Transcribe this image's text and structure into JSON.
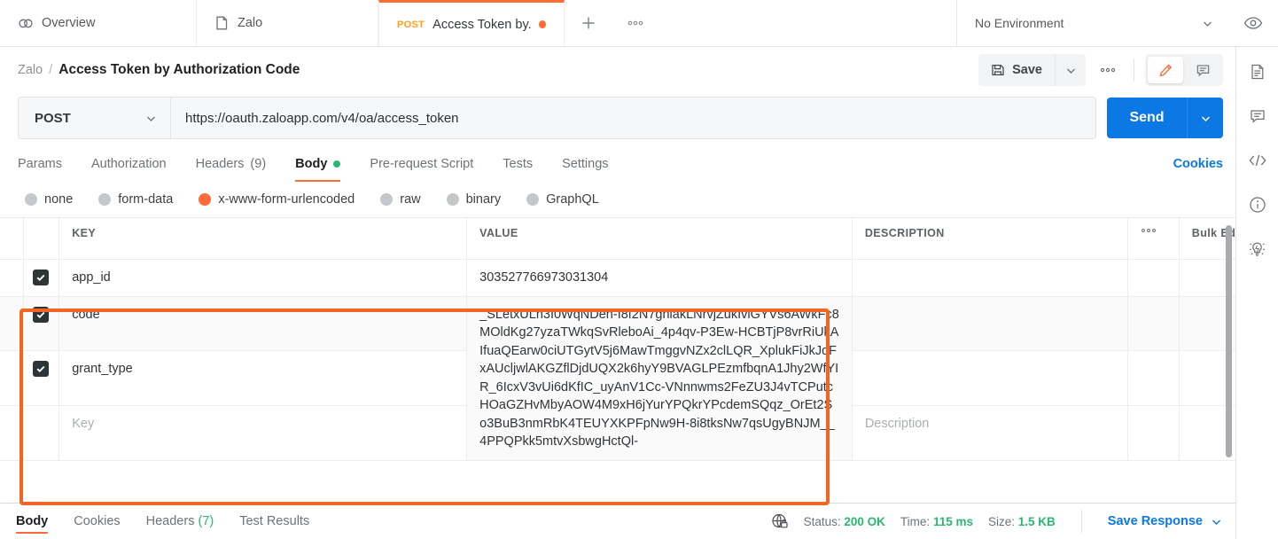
{
  "tabs": [
    {
      "label": "Overview",
      "icon": "postman-overview-icon"
    },
    {
      "label": "Zalo",
      "icon": "collection-icon"
    },
    {
      "label": "Access Token by...",
      "method": "POST",
      "icon": "request-icon"
    }
  ],
  "tabbar": {
    "add_label": "+",
    "more_label": "000",
    "environment": "No Environment",
    "eye_icon": "eye-icon"
  },
  "breadcrumb": {
    "collection": "Zalo",
    "separator": "/",
    "title": "Access Token by Authorization Code"
  },
  "actions": {
    "save_label": "Save",
    "save_caret": "chevron-down-icon",
    "more_label": "000",
    "edit_icon": "pencil-icon",
    "comment_icon": "comment-icon"
  },
  "request": {
    "method": "POST",
    "url": "https://oauth.zaloapp.com/v4/oa/access_token",
    "send_label": "Send"
  },
  "request_tabs": [
    {
      "label": "Params",
      "active": false
    },
    {
      "label": "Authorization",
      "active": false
    },
    {
      "label": "Headers",
      "count": "(9)",
      "active": false
    },
    {
      "label": "Body",
      "active": true,
      "dot": true
    },
    {
      "label": "Pre-request Script",
      "active": false
    },
    {
      "label": "Tests",
      "active": false
    },
    {
      "label": "Settings",
      "active": false
    }
  ],
  "cookies_link": "Cookies",
  "body_types": [
    {
      "label": "none",
      "selected": false
    },
    {
      "label": "form-data",
      "selected": false
    },
    {
      "label": "x-www-form-urlencoded",
      "selected": true
    },
    {
      "label": "raw",
      "selected": false
    },
    {
      "label": "binary",
      "selected": false
    },
    {
      "label": "GraphQL",
      "selected": false
    }
  ],
  "table": {
    "headers": {
      "key": "KEY",
      "value": "VALUE",
      "description": "DESCRIPTION",
      "options": "000",
      "bulk_edit": "Bulk Edit"
    },
    "rows": [
      {
        "checked": true,
        "key": "app_id",
        "value": "303527766973031304",
        "description": ""
      },
      {
        "checked": true,
        "key": "code",
        "value": "_SLetxULh3I0WqNDeh-I8f2N7ghiakLNrvjZukIviGYVs6AWkFc8MOldKg27yzaTWkqSvRleboAi_4p4qv-P3Ew-HCBTjP8vrRiUkAIfuaQEarw0ciUTGytV5j6MawTmggvNZx2clLQR_XplukFiJkJqFxAUcljwlAKGZflDjdUQX2k6hyY9BVAGLPEzmfbqnA1Jhy2WfYIR_6IcxV3vUi6dKfIC_uyAnV1Cc-VNnnwms2FeZU3J4vTCPutcHOaGZHvMbyAOW4M9xH6jYurYPQkrYPcdemSQqz_OrEt2So3BuB3nmRbK4TEUYXKPFpNw9H-8i8tksNw7qsUgyBNJM__4PPQPkk5mtvXsbwgHctQl-",
        "description": ""
      },
      {
        "checked": true,
        "key": "grant_type",
        "value": "",
        "description": ""
      },
      {
        "checked": false,
        "key": "",
        "key_placeholder": "Key",
        "value": "",
        "description_placeholder": "Description"
      }
    ]
  },
  "response": {
    "tabs": [
      {
        "label": "Body",
        "active": true
      },
      {
        "label": "Cookies",
        "active": false
      },
      {
        "label": "Headers",
        "count": "(7)",
        "active": false
      },
      {
        "label": "Test Results",
        "active": false
      }
    ],
    "status_label": "Status:",
    "status_value": "200 OK",
    "time_label": "Time:",
    "time_value": "115 ms",
    "size_label": "Size:",
    "size_value": "1.5 KB",
    "save_response": "Save Response",
    "globe_icon": "globe-lock-icon"
  },
  "rail_icons": [
    "document-icon",
    "comment-icon",
    "code-icon",
    "info-icon",
    "lightbulb-icon"
  ],
  "colors": {
    "accent_orange": "#ff6c37",
    "annotation": "#f26522",
    "send_blue": "#0b78e3",
    "status_green": "#2bb673"
  }
}
